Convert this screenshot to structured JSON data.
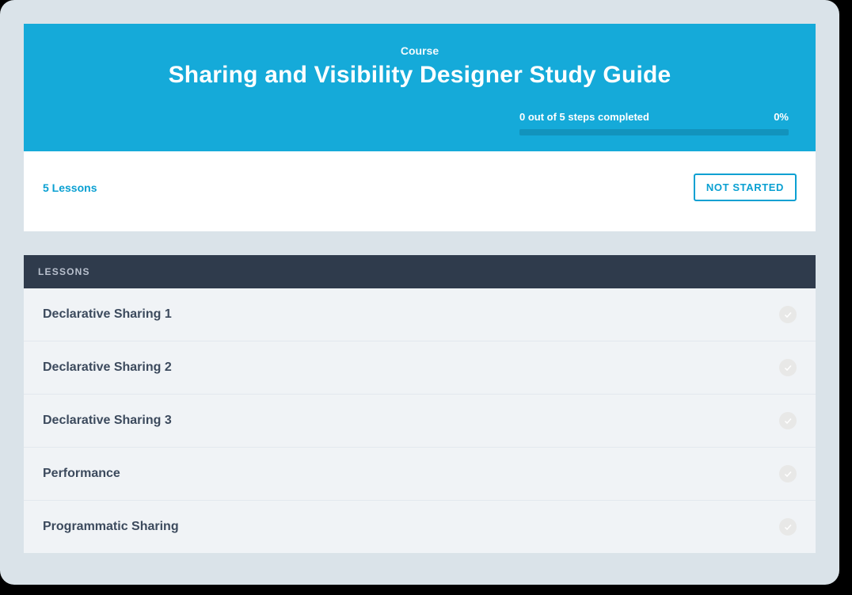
{
  "header": {
    "kicker": "Course",
    "title": "Sharing and Visibility Designer Study Guide",
    "progress_text": "0 out of 5 steps completed",
    "progress_percent_label": "0%",
    "progress_percent_value": 0
  },
  "status": {
    "lessons_count_label": "5 Lessons",
    "badge": "NOT STARTED"
  },
  "lessons_header": "LESSONS",
  "lessons": [
    {
      "title": "Declarative Sharing 1",
      "completed": false
    },
    {
      "title": "Declarative Sharing 2",
      "completed": false
    },
    {
      "title": "Declarative Sharing 3",
      "completed": false
    },
    {
      "title": "Performance",
      "completed": false
    },
    {
      "title": "Programmatic Sharing",
      "completed": false
    }
  ]
}
